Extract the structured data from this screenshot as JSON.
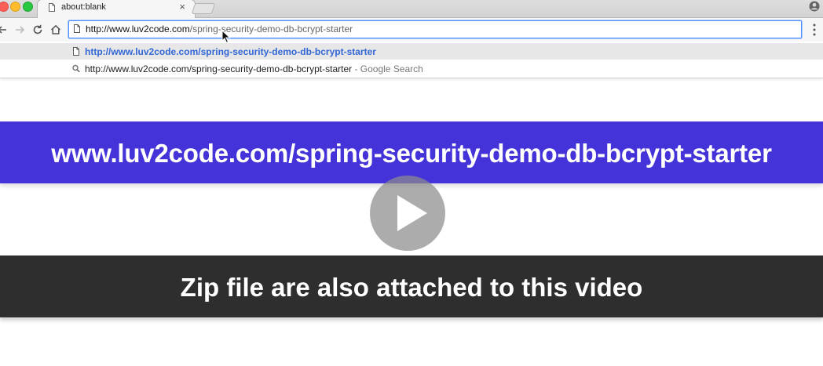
{
  "browser": {
    "tab": {
      "title": "about:blank",
      "close_glyph": "×"
    },
    "omnibox": {
      "url_host": "http://www.luv2code.com",
      "url_path": "/spring-security-demo-db-bcrypt-starter"
    },
    "suggestions": [
      {
        "text": "http://www.luv2code.com/spring-security-demo-db-bcrypt-starter",
        "suffix": "",
        "icon": "page-icon"
      },
      {
        "text": "http://www.luv2code.com/spring-security-demo-db-bcrypt-starter",
        "suffix": " - Google Search",
        "icon": "search-icon"
      }
    ]
  },
  "video": {
    "banner_url": "www.luv2code.com/spring-security-demo-db-bcrypt-starter",
    "caption": "Zip file are also attached to this video",
    "colors": {
      "banner": "#4433d9",
      "caption_bar": "#2e2e2e",
      "link": "#3367d6"
    }
  }
}
